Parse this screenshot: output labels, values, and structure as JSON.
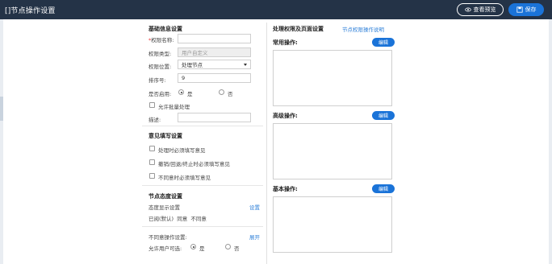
{
  "header": {
    "title": "[]节点操作设置",
    "preview_label": "查看预览",
    "save_label": "保存"
  },
  "basic": {
    "section_title": "基础信息设置",
    "name_label": "*权限名称:",
    "name_value": "",
    "type_label": "权限类型:",
    "type_value": "用户自定义",
    "position_label": "权限位置:",
    "position_value": "处理节点",
    "order_label": "排序号:",
    "order_value": "9",
    "enabled_label": "是否启用:",
    "yes_label": "是",
    "no_label": "否",
    "batch_label": "允许批量处理",
    "desc_label": "描述:",
    "desc_value": ""
  },
  "opinion": {
    "section_title": "意见填写设置",
    "options": [
      "处理时必须填写意见",
      "撤销/回退/终止时必须填写意见",
      "不同意时必须填写意见"
    ]
  },
  "attitude": {
    "section_title": "节点态度设置",
    "display_label": "态度显示设置",
    "settings_link": "设置",
    "values_text": "已阅(默认)  同意  不同意",
    "disagree_label": "不同意操作设置:",
    "expand_link": "展开",
    "allow_select_label": "允许用户可选:",
    "yes_label": "是",
    "no_label": "否"
  },
  "permissions": {
    "section_title": "处理权限及页面设置",
    "help_link": "节点权限操作说明",
    "edit_label": "编辑",
    "groups": [
      {
        "label": "常用操作:"
      },
      {
        "label": "高级操作:"
      },
      {
        "label": "基本操作:"
      }
    ]
  },
  "colors": {
    "header_bg": "#243347",
    "accent": "#1a73d8",
    "link": "#2d7fd8"
  }
}
